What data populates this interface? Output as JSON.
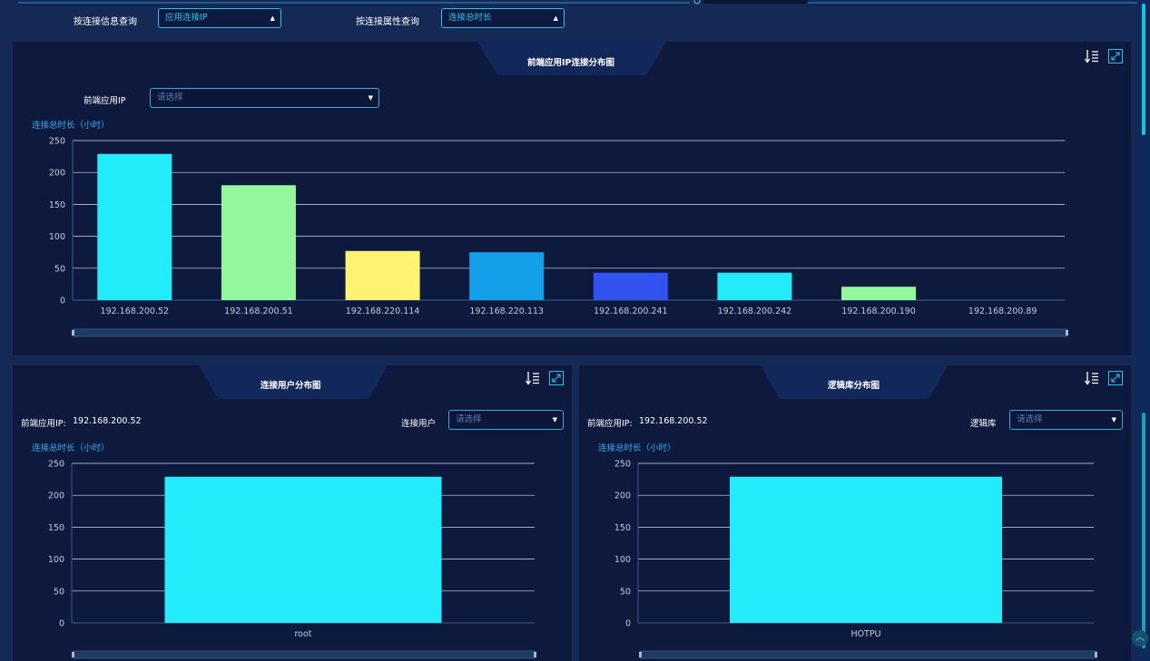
{
  "filters": {
    "conn_info_label": "按连接信息查询",
    "conn_info_value": "应用连接IP",
    "conn_attr_label": "按连接属性查询",
    "conn_attr_value": "连接总时长"
  },
  "top_panel": {
    "title": "前端应用IP连接分布图",
    "select_label": "前端应用IP",
    "select_placeholder": "请选择"
  },
  "left_panel": {
    "title": "连接用户分布图",
    "ip_label": "前端应用IP:",
    "ip_value": "192.168.200.52",
    "select_label": "连接用户",
    "select_placeholder": "请选择"
  },
  "right_panel": {
    "title": "逻辑库分布图",
    "ip_label": "前端应用IP:",
    "ip_value": "192.168.200.52",
    "select_label": "逻辑库",
    "select_placeholder": "请选择"
  },
  "icons": [
    "sort-icon",
    "expand-icon",
    "chevron-up-icon"
  ],
  "colors": {
    "background": "#142a55",
    "panel": "#0d1a3e",
    "accent": "#2cc1e8",
    "bar_cyan": "#22ecfa",
    "bar_green": "#93f89d",
    "bar_yellow": "#fdf274",
    "bar_blue": "#13a0e9",
    "bar_indigo": "#3253ef"
  },
  "chart_data": [
    {
      "type": "bar",
      "title": "前端应用IP连接分布图",
      "ylabel": "连接总时长（小时）",
      "categories": [
        "192.168.200.52",
        "192.168.200.51",
        "192.168.220.114",
        "192.168.220.113",
        "192.168.200.241",
        "192.168.200.242",
        "192.168.200.190",
        "192.168.200.89"
      ],
      "values": [
        229,
        180,
        77,
        75,
        43,
        43,
        21,
        0
      ],
      "bar_colors": [
        "#22ecfa",
        "#93f89d",
        "#fdf274",
        "#13a0e9",
        "#3253ef",
        "#22ecfa",
        "#93f89d",
        "#fdf274"
      ],
      "yticks": [
        0,
        50,
        100,
        150,
        200,
        250
      ],
      "ylim": [
        0,
        250
      ],
      "grid": true
    },
    {
      "type": "bar",
      "title": "连接用户分布图",
      "ylabel": "连接总时长（小时）",
      "categories": [
        "root"
      ],
      "values": [
        229
      ],
      "bar_colors": [
        "#22ecfa"
      ],
      "yticks": [
        0,
        50,
        100,
        150,
        200,
        250
      ],
      "ylim": [
        0,
        250
      ],
      "grid": true
    },
    {
      "type": "bar",
      "title": "逻辑库分布图",
      "ylabel": "连接总时长（小时）",
      "categories": [
        "HOTPU"
      ],
      "values": [
        229
      ],
      "bar_colors": [
        "#22ecfa"
      ],
      "yticks": [
        0,
        50,
        100,
        150,
        200,
        250
      ],
      "ylim": [
        0,
        250
      ],
      "grid": true
    }
  ]
}
